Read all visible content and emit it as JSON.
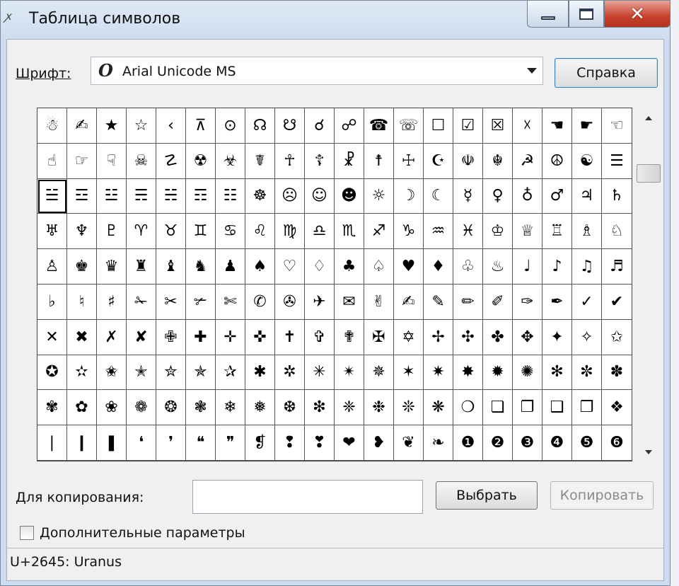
{
  "window": {
    "title": "Таблица символов",
    "app_icon": "ꭗ",
    "controls": {
      "minimize": "minimize-icon",
      "maximize": "maximize-icon",
      "close": "✕"
    }
  },
  "font": {
    "label": "Шрифт:",
    "value": "Arial Unicode MS",
    "icon": "O"
  },
  "help_button": "Справка",
  "grid": {
    "rows": [
      [
        "☃",
        "✍",
        "★",
        "☆",
        "‹",
        "⊼",
        "⊙",
        "☊",
        "☋",
        "☌",
        "☍",
        "☎",
        "☏",
        "☐",
        "☑",
        "☒",
        "☓",
        "☚",
        "☛",
        "☜"
      ],
      [
        "☝",
        "☞",
        "☟",
        "☠",
        "☡",
        "☢",
        "☣",
        "☤",
        "☥",
        "☦",
        "☧",
        "☨",
        "☩",
        "☪",
        "☫",
        "☬",
        "☭",
        "☮",
        "☯",
        "☰"
      ],
      [
        "☱",
        "☲",
        "☳",
        "☴",
        "☵",
        "☶",
        "☷",
        "☸",
        "☹",
        "☺",
        "☻",
        "☼",
        "☽",
        "☾",
        "☿",
        "♀",
        "♁",
        "♂",
        "♃",
        "♄"
      ],
      [
        "♅",
        "♆",
        "♇",
        "♈",
        "♉",
        "♊",
        "♋",
        "♌",
        "♍",
        "♎",
        "♏",
        "♐",
        "♑",
        "♒",
        "♓",
        "♔",
        "♕",
        "♖",
        "♗",
        "♘"
      ],
      [
        "♙",
        "♚",
        "♛",
        "♜",
        "♝",
        "♞",
        "♟",
        "♠",
        "♡",
        "♢",
        "♣",
        "♤",
        "♥",
        "♦",
        "♧",
        "♨",
        "♩",
        "♪",
        "♫",
        "♬"
      ],
      [
        "♭",
        "♮",
        "♯",
        "✁",
        "✂",
        "✃",
        "✄",
        "✆",
        "✇",
        "✈",
        "✉",
        "✌",
        "✍",
        "✎",
        "✏",
        "✐",
        "✑",
        "✒",
        "✓",
        "✔"
      ],
      [
        "✕",
        "✖",
        "✗",
        "✘",
        "✙",
        "✚",
        "✛",
        "✜",
        "✝",
        "✞",
        "✟",
        "✠",
        "✡",
        "✢",
        "✣",
        "✤",
        "✥",
        "✦",
        "✧",
        "✩"
      ],
      [
        "✪",
        "✫",
        "✬",
        "✭",
        "✮",
        "✯",
        "✰",
        "✱",
        "✲",
        "✳",
        "✴",
        "✵",
        "✶",
        "✷",
        "✸",
        "✹",
        "✺",
        "✻",
        "✼",
        "✽"
      ],
      [
        "✾",
        "✿",
        "❀",
        "❁",
        "❂",
        "❃",
        "❄",
        "❅",
        "❆",
        "❇",
        "❈",
        "❉",
        "❊",
        "❋",
        "❍",
        "❏",
        "❐",
        "❑",
        "❒",
        "❖"
      ],
      [
        "❘",
        "❙",
        "❚",
        "❛",
        "❜",
        "❝",
        "❞",
        "❡",
        "❢",
        "❣",
        "❤",
        "❥",
        "❦",
        "❧",
        "❶",
        "❷",
        "❸",
        "❹",
        "❺",
        "❻"
      ]
    ],
    "selected": {
      "row": 2,
      "col": 0
    }
  },
  "copy": {
    "label": "Для копирования:",
    "value": "",
    "select_button": "Выбрать",
    "copy_button": "Копировать"
  },
  "advanced": {
    "label": "Дополнительные параметры",
    "checked": false
  },
  "status": "U+2645: Uranus"
}
